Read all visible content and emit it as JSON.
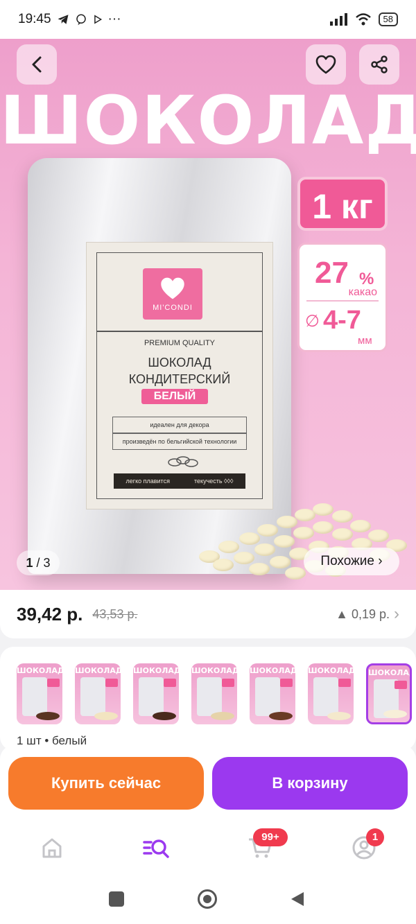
{
  "status_bar": {
    "time": "19:45",
    "battery": "58",
    "more": "···"
  },
  "hero": {
    "title": "ШОКОЛАД",
    "counter_current": "1",
    "counter_sep": " / ",
    "counter_total": "3",
    "similar_label": "Похожие ›",
    "tag_weight": "1 кг",
    "cacao_value": "27",
    "cacao_unit": "%",
    "cacao_label": "какао",
    "size_symbol": "∅",
    "size_value": "4-7",
    "size_unit": "мм",
    "label": {
      "brand": "MI'CONDI",
      "quality": "PREMIUM QUALITY",
      "name_line1": "ШОКОЛАД",
      "name_line2": "КОНДИТЕРСКИЙ",
      "type": "БЕЛЫЙ",
      "feature1": "идеален для декора",
      "feature2": "произведён по бельгийской технологии",
      "bottom_left": "легко плавится",
      "bottom_right": "текучесть ◊◊◊"
    }
  },
  "price": {
    "current": "39,42 р.",
    "old": "43,53 р.",
    "change": "▲ 0,19 р.",
    "chevron": "›"
  },
  "variants": {
    "thumbs": [
      {
        "title": "ШОКОЛАД",
        "pile": "#5a3422"
      },
      {
        "title": "ШОКОЛАД",
        "pile": "#f2e4c0"
      },
      {
        "title": "ШОКОЛАД",
        "pile": "#4a2a1c"
      },
      {
        "title": "ШОКОЛАД",
        "pile": "#e6d3a9"
      },
      {
        "title": "ШОКОЛАД",
        "pile": "#6a3a25"
      },
      {
        "title": "ШОКОЛАД",
        "pile": "#f4e9cc"
      },
      {
        "title": "ШОКОЛАД",
        "pile": "#f7efd8"
      }
    ],
    "selected_index": 6,
    "selection_text": "1 шт • белый"
  },
  "actions": {
    "buy_now": "Купить сейчас",
    "add_to_cart": "В корзину"
  },
  "tabbar": {
    "cart_badge": "99+",
    "profile_badge": "1"
  },
  "colors": {
    "accent_purple": "#9b39ef",
    "accent_orange": "#f77b2c",
    "brand_pink": "#f05a97"
  }
}
